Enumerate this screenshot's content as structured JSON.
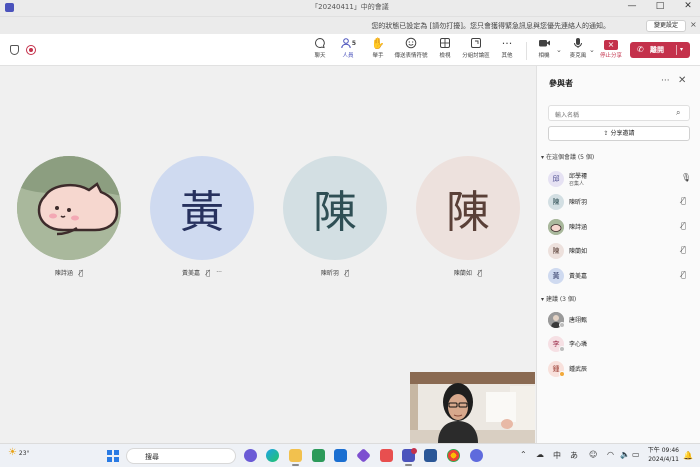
{
  "window": {
    "title": "「20240411」中的會議",
    "controls": [
      "—",
      "□",
      "✕"
    ]
  },
  "banner": {
    "text": "您的狀態已設定為 [請勿打擾]。您只會獲得緊急訊息與您優先連絡人的通知。",
    "close": "×",
    "change_settings": "變更設定"
  },
  "toolbar": {
    "chat": "聊天",
    "people": "人員",
    "people_count": "5",
    "raise": "舉手",
    "react": "傳送表情符號",
    "view": "檢視",
    "rooms": "分組討論區",
    "more": "其他",
    "camera": "相機",
    "mic": "麥克風",
    "stop_share": "停止分享",
    "leave": "離開"
  },
  "stage": {
    "tiles": [
      {
        "name": "陳詩涵",
        "initial": ""
      },
      {
        "name": "黃美嘉",
        "initial": "黃"
      },
      {
        "name": "陳昕羽",
        "initial": "陳"
      },
      {
        "name": "陳蘭如",
        "initial": "陳"
      }
    ],
    "more_options": "···"
  },
  "panel": {
    "title": "參與者",
    "search_placeholder": "輸入名稱",
    "share_invite": "分享邀請",
    "in_meeting_label": "在這個會議 (5 個)",
    "in_meeting": [
      {
        "name": "邱學褼",
        "role": "召集人",
        "initial": "邱"
      },
      {
        "name": "陳昕羽",
        "initial": "陳"
      },
      {
        "name": "陳詩涵",
        "initial": ""
      },
      {
        "name": "陳蘭如",
        "initial": "陳"
      },
      {
        "name": "黃美嘉",
        "initial": "黃"
      }
    ],
    "suggested_label": "建議 (3 個)",
    "suggested": [
      {
        "name": "唐翊甄",
        "initial": ""
      },
      {
        "name": "李心璘",
        "initial": "李"
      },
      {
        "name": "鍾武辰",
        "initial": "鍾"
      }
    ]
  },
  "taskbar": {
    "temperature": "23°",
    "search": "搜尋",
    "time": "下午 09:46",
    "date": "2024/4/11",
    "ime": "あ"
  },
  "colors": {
    "accent": "#4b53bc",
    "leave": "#c4314b"
  }
}
